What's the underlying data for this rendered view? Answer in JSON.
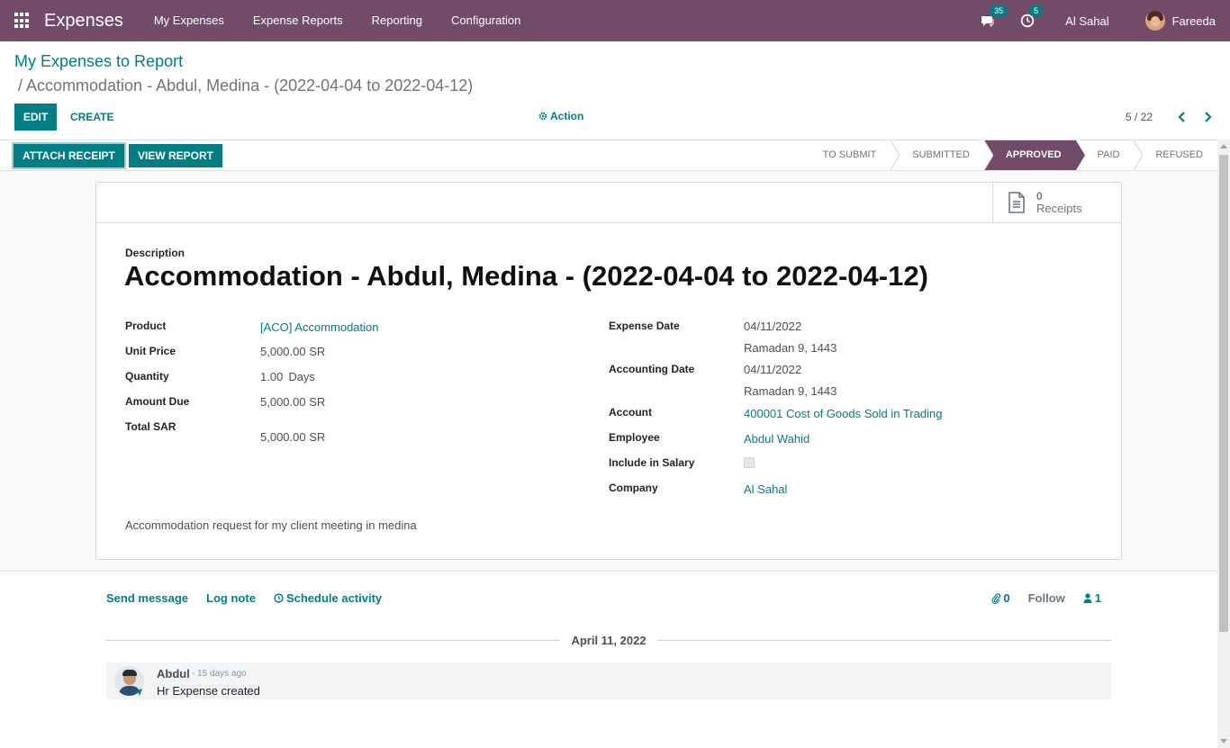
{
  "app": {
    "title": "Expenses"
  },
  "nav": {
    "items": [
      "My Expenses",
      "Expense Reports",
      "Reporting",
      "Configuration"
    ],
    "messages_count": "35",
    "activities_count": "5",
    "company": "Al Sahal",
    "user": "Fareeda"
  },
  "breadcrumb": {
    "parent": "My Expenses to Report",
    "current": "/ Accommodation - Abdul, Medina - (2022-04-04 to 2022-04-12)"
  },
  "toolbar": {
    "edit_label": "EDIT",
    "create_label": "CREATE",
    "action_label": "Action",
    "pager": "5 / 22"
  },
  "statusbar": {
    "attach_label": "ATTACH RECEIPT",
    "view_report_label": "VIEW REPORT",
    "stages": [
      "TO SUBMIT",
      "SUBMITTED",
      "APPROVED",
      "PAID",
      "REFUSED"
    ],
    "active_stage": "APPROVED"
  },
  "sheet": {
    "receipts_count": "0",
    "receipts_label": "Receipts",
    "description_label": "Description",
    "description": "Accommodation - Abdul, Medina - (2022-04-04 to 2022-04-12)",
    "left": {
      "product_label": "Product",
      "product": "[ACO] Accommodation",
      "unit_price_label": "Unit Price",
      "unit_price": "5,000.00 SR",
      "quantity_label": "Quantity",
      "quantity": "1.00",
      "quantity_uom": "Days",
      "amount_due_label": "Amount Due",
      "amount_due": "5,000.00 SR",
      "total_label": "Total SAR",
      "total": "5,000.00 SR"
    },
    "right": {
      "expense_date_label": "Expense Date",
      "expense_date": "04/11/2022",
      "expense_date_hijri": "Ramadan 9, 1443",
      "accounting_date_label": "Accounting Date",
      "accounting_date": "04/11/2022",
      "accounting_date_hijri": "Ramadan 9, 1443",
      "account_label": "Account",
      "account": "400001 Cost of Goods Sold in Trading",
      "employee_label": "Employee",
      "employee": "Abdul Wahid",
      "include_salary_label": "Include in Salary",
      "company_label": "Company",
      "company": "Al Sahal"
    },
    "notes": "Accommodation request for my client meeting in medina"
  },
  "chatter": {
    "send_message": "Send message",
    "log_note": "Log note",
    "schedule_activity": "Schedule activity",
    "attachments_count": "0",
    "follow": "Follow",
    "followers_count": "1",
    "date_separator": "April 11, 2022",
    "message": {
      "author": "Abdul",
      "time": "- 15 days ago",
      "body": "Hr Expense created"
    }
  },
  "colors": {
    "brand": "#714B67",
    "accent": "#017E84"
  }
}
